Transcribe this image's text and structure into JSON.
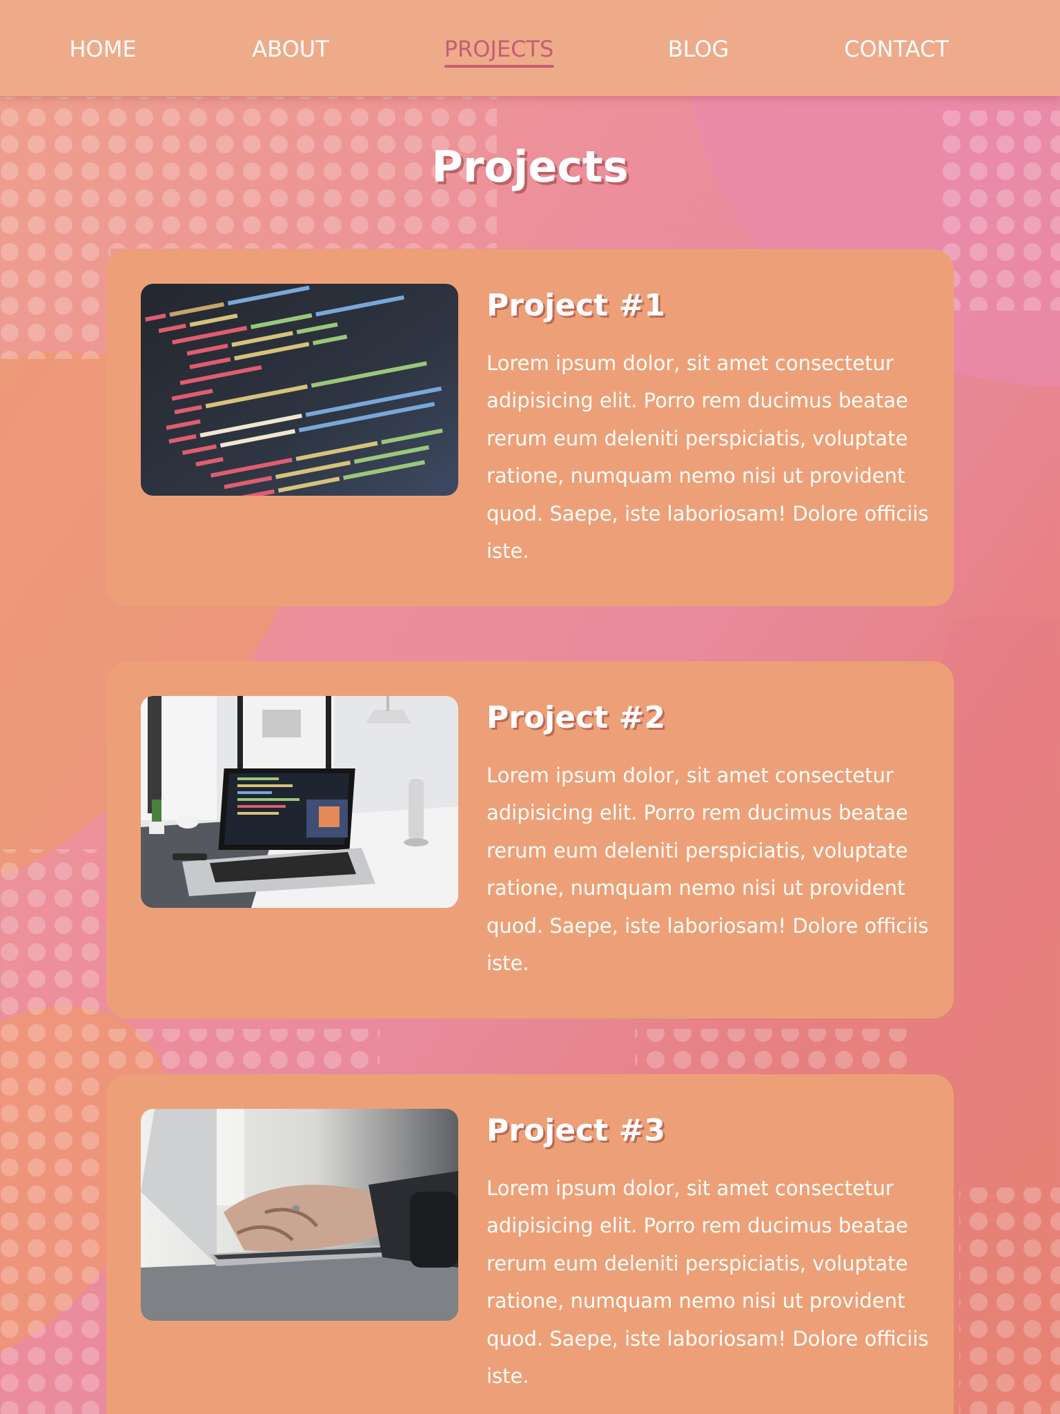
{
  "nav": {
    "items": [
      {
        "label": "HOME"
      },
      {
        "label": "ABOUT"
      },
      {
        "label": "PROJECTS",
        "active": true
      },
      {
        "label": "BLOG"
      },
      {
        "label": "CONTACT"
      }
    ]
  },
  "page": {
    "title": "Projects"
  },
  "projects": [
    {
      "title": "Project #1",
      "description": "Lorem ipsum dolor, sit amet consectetur adipisicing elit. Porro rem ducimus beatae rerum eum deleniti perspiciatis, voluptate ratione, numquam nemo nisi ut provident quod. Saepe, iste laboriosam! Dolore officiis iste.",
      "image": "code-screen-photo"
    },
    {
      "title": "Project #2",
      "description": "Lorem ipsum dolor, sit amet consectetur adipisicing elit. Porro rem ducimus beatae rerum eum deleniti perspiciatis, voluptate ratione, numquam nemo nisi ut provident quod. Saepe, iste laboriosam! Dolore officiis iste.",
      "image": "laptop-desk-photo"
    },
    {
      "title": "Project #3",
      "description": "Lorem ipsum dolor, sit amet consectetur adipisicing elit. Porro rem ducimus beatae rerum eum deleniti perspiciatis, voluptate ratione, numquam nemo nisi ut provident quod. Saepe, iste laboriosam! Dolore officiis iste.",
      "image": "typing-hands-photo"
    }
  ],
  "colors": {
    "accent": "#c45e72",
    "nav_bg": "#edab89",
    "card_bg": "#eda077",
    "text": "#ffffff"
  }
}
